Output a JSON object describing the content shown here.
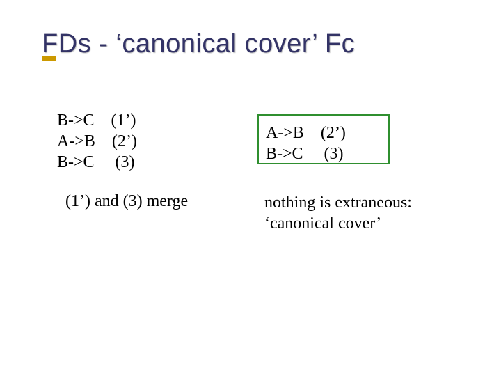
{
  "title": "FDs - ‘canonical cover’ Fc",
  "left": {
    "fds": [
      "B->C    (1’)",
      "A->B    (2’)",
      "B->C     (3)"
    ],
    "caption": "(1’) and (3) merge"
  },
  "right": {
    "fds": [
      "A->B    (2’)",
      "B->C     (3)"
    ],
    "caption_line1": "nothing is extraneous:",
    "caption_line2": "‘canonical cover’"
  }
}
